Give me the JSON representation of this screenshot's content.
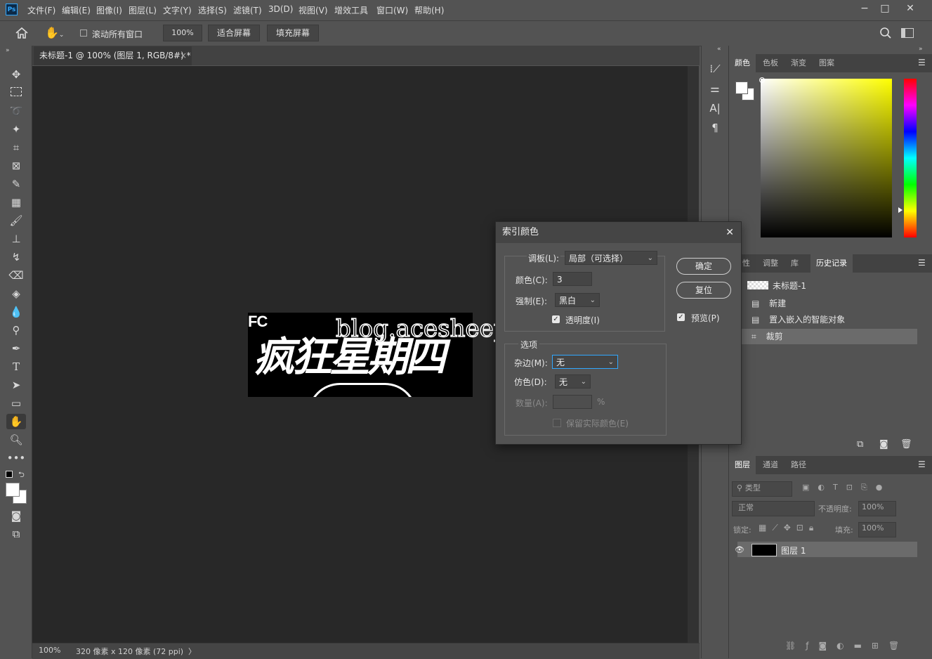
{
  "menubar": {
    "app_logo": "Ps",
    "items": [
      "文件(F)",
      "编辑(E)",
      "图像(I)",
      "图层(L)",
      "文字(Y)",
      "选择(S)",
      "滤镜(T)",
      "3D(D)",
      "视图(V)",
      "增效工具",
      "窗口(W)",
      "帮助(H)"
    ],
    "window_controls": {
      "minimize": "−",
      "maximize": "□",
      "close": "✕"
    }
  },
  "options_bar": {
    "scroll_all_label": "滚动所有窗口",
    "zoom_value": "100%",
    "fit_screen": "适合屏幕",
    "fill_screen": "填充屏幕"
  },
  "document": {
    "tab_title": "未标题-1 @ 100% (图层 1, RGB/8#) *",
    "tab_close": "×",
    "image_text_top": "FC",
    "image_text_main": "疯狂星期四",
    "watermark": "blog.acesheep.com"
  },
  "status_bar": {
    "zoom": "100%",
    "doc_info": "320 像素 x 120 像素 (72 ppi)",
    "arrow": "〉"
  },
  "color_panel": {
    "tabs": [
      "颜色",
      "色板",
      "渐变",
      "图案"
    ],
    "active_tab": "颜色"
  },
  "history_panel": {
    "tabs": [
      "属性",
      "调整",
      "库",
      "历史记录"
    ],
    "active_tab": "历史记录",
    "snapshot_name": "未标题-1",
    "steps": [
      {
        "label": "新建",
        "selected": false
      },
      {
        "label": "置入嵌入的智能对象",
        "selected": false
      },
      {
        "label": "裁剪",
        "selected": true
      }
    ]
  },
  "layers_panel": {
    "tabs": [
      "图层",
      "通道",
      "路径"
    ],
    "active_tab": "图层",
    "filter_placeholder": "类型",
    "blend_mode": "正常",
    "opacity_label": "不透明度:",
    "opacity_value": "100%",
    "lock_label": "锁定:",
    "fill_label": "填充:",
    "fill_value": "100%",
    "layers": [
      {
        "name": "图层 1",
        "visible": true
      }
    ]
  },
  "dialog": {
    "title": "索引颜色",
    "palette_label": "调板(L):",
    "palette_value": "局部（可选择）",
    "colors_label": "颜色(C):",
    "colors_value": "3",
    "forced_label": "强制(E):",
    "forced_value": "黑白",
    "transparency_label": "透明度(I)",
    "transparency_checked": true,
    "options_legend": "选项",
    "matte_label": "杂边(M):",
    "matte_value": "无",
    "dither_label": "仿色(D):",
    "dither_value": "无",
    "amount_label": "数量(A):",
    "amount_unit": "%",
    "preserve_label": "保留实际颜色(E)",
    "ok_button": "确定",
    "reset_button": "复位",
    "preview_label": "预览(P)",
    "preview_checked": true
  },
  "colors": {
    "accent_blue": "#31a8ff",
    "app_bg": "#535353",
    "canvas_bg": "#282828"
  }
}
